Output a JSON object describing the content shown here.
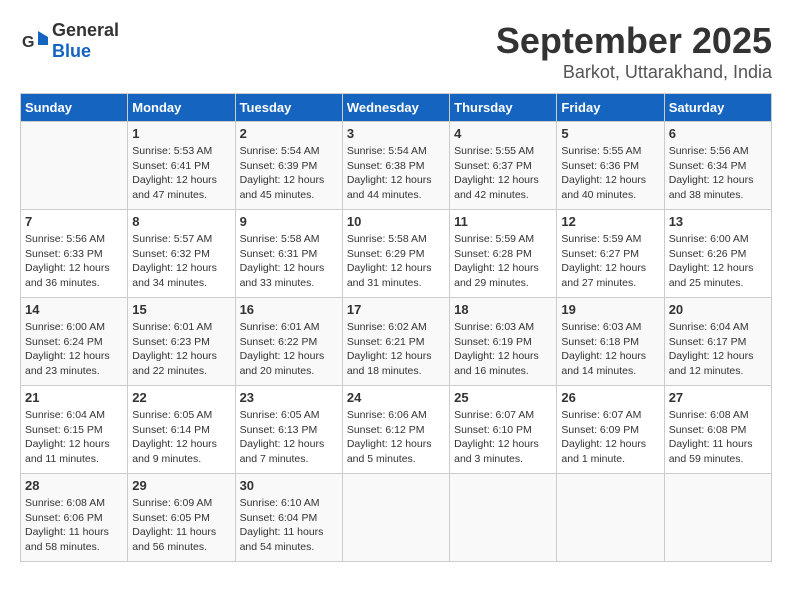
{
  "header": {
    "logo_general": "General",
    "logo_blue": "Blue",
    "month_title": "September 2025",
    "location": "Barkot, Uttarakhand, India"
  },
  "columns": [
    "Sunday",
    "Monday",
    "Tuesday",
    "Wednesday",
    "Thursday",
    "Friday",
    "Saturday"
  ],
  "weeks": [
    [
      {
        "day": "",
        "info": ""
      },
      {
        "day": "1",
        "info": "Sunrise: 5:53 AM\nSunset: 6:41 PM\nDaylight: 12 hours\nand 47 minutes."
      },
      {
        "day": "2",
        "info": "Sunrise: 5:54 AM\nSunset: 6:39 PM\nDaylight: 12 hours\nand 45 minutes."
      },
      {
        "day": "3",
        "info": "Sunrise: 5:54 AM\nSunset: 6:38 PM\nDaylight: 12 hours\nand 44 minutes."
      },
      {
        "day": "4",
        "info": "Sunrise: 5:55 AM\nSunset: 6:37 PM\nDaylight: 12 hours\nand 42 minutes."
      },
      {
        "day": "5",
        "info": "Sunrise: 5:55 AM\nSunset: 6:36 PM\nDaylight: 12 hours\nand 40 minutes."
      },
      {
        "day": "6",
        "info": "Sunrise: 5:56 AM\nSunset: 6:34 PM\nDaylight: 12 hours\nand 38 minutes."
      }
    ],
    [
      {
        "day": "7",
        "info": "Sunrise: 5:56 AM\nSunset: 6:33 PM\nDaylight: 12 hours\nand 36 minutes."
      },
      {
        "day": "8",
        "info": "Sunrise: 5:57 AM\nSunset: 6:32 PM\nDaylight: 12 hours\nand 34 minutes."
      },
      {
        "day": "9",
        "info": "Sunrise: 5:58 AM\nSunset: 6:31 PM\nDaylight: 12 hours\nand 33 minutes."
      },
      {
        "day": "10",
        "info": "Sunrise: 5:58 AM\nSunset: 6:29 PM\nDaylight: 12 hours\nand 31 minutes."
      },
      {
        "day": "11",
        "info": "Sunrise: 5:59 AM\nSunset: 6:28 PM\nDaylight: 12 hours\nand 29 minutes."
      },
      {
        "day": "12",
        "info": "Sunrise: 5:59 AM\nSunset: 6:27 PM\nDaylight: 12 hours\nand 27 minutes."
      },
      {
        "day": "13",
        "info": "Sunrise: 6:00 AM\nSunset: 6:26 PM\nDaylight: 12 hours\nand 25 minutes."
      }
    ],
    [
      {
        "day": "14",
        "info": "Sunrise: 6:00 AM\nSunset: 6:24 PM\nDaylight: 12 hours\nand 23 minutes."
      },
      {
        "day": "15",
        "info": "Sunrise: 6:01 AM\nSunset: 6:23 PM\nDaylight: 12 hours\nand 22 minutes."
      },
      {
        "day": "16",
        "info": "Sunrise: 6:01 AM\nSunset: 6:22 PM\nDaylight: 12 hours\nand 20 minutes."
      },
      {
        "day": "17",
        "info": "Sunrise: 6:02 AM\nSunset: 6:21 PM\nDaylight: 12 hours\nand 18 minutes."
      },
      {
        "day": "18",
        "info": "Sunrise: 6:03 AM\nSunset: 6:19 PM\nDaylight: 12 hours\nand 16 minutes."
      },
      {
        "day": "19",
        "info": "Sunrise: 6:03 AM\nSunset: 6:18 PM\nDaylight: 12 hours\nand 14 minutes."
      },
      {
        "day": "20",
        "info": "Sunrise: 6:04 AM\nSunset: 6:17 PM\nDaylight: 12 hours\nand 12 minutes."
      }
    ],
    [
      {
        "day": "21",
        "info": "Sunrise: 6:04 AM\nSunset: 6:15 PM\nDaylight: 12 hours\nand 11 minutes."
      },
      {
        "day": "22",
        "info": "Sunrise: 6:05 AM\nSunset: 6:14 PM\nDaylight: 12 hours\nand 9 minutes."
      },
      {
        "day": "23",
        "info": "Sunrise: 6:05 AM\nSunset: 6:13 PM\nDaylight: 12 hours\nand 7 minutes."
      },
      {
        "day": "24",
        "info": "Sunrise: 6:06 AM\nSunset: 6:12 PM\nDaylight: 12 hours\nand 5 minutes."
      },
      {
        "day": "25",
        "info": "Sunrise: 6:07 AM\nSunset: 6:10 PM\nDaylight: 12 hours\nand 3 minutes."
      },
      {
        "day": "26",
        "info": "Sunrise: 6:07 AM\nSunset: 6:09 PM\nDaylight: 12 hours\nand 1 minute."
      },
      {
        "day": "27",
        "info": "Sunrise: 6:08 AM\nSunset: 6:08 PM\nDaylight: 11 hours\nand 59 minutes."
      }
    ],
    [
      {
        "day": "28",
        "info": "Sunrise: 6:08 AM\nSunset: 6:06 PM\nDaylight: 11 hours\nand 58 minutes."
      },
      {
        "day": "29",
        "info": "Sunrise: 6:09 AM\nSunset: 6:05 PM\nDaylight: 11 hours\nand 56 minutes."
      },
      {
        "day": "30",
        "info": "Sunrise: 6:10 AM\nSunset: 6:04 PM\nDaylight: 11 hours\nand 54 minutes."
      },
      {
        "day": "",
        "info": ""
      },
      {
        "day": "",
        "info": ""
      },
      {
        "day": "",
        "info": ""
      },
      {
        "day": "",
        "info": ""
      }
    ]
  ]
}
